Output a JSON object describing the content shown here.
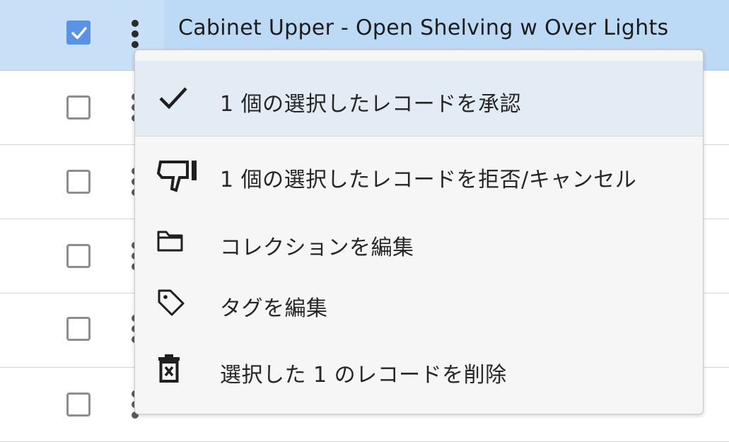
{
  "selected_row": {
    "title": "Cabinet Upper - Open Shelving w Over Lights"
  },
  "icons": {
    "row_checkbox_checked": "checkbox-checked-icon",
    "row_menu": "kebab-menu-icon",
    "approve": "check-icon",
    "reject": "thumbs-down-icon",
    "collection": "folder-icon",
    "tag": "tag-icon",
    "delete": "trash-icon"
  },
  "context_menu": {
    "approve_label": "1 個の選択したレコードを承認",
    "reject_label": "1 個の選択したレコードを拒否/キャンセル",
    "collection_label": "コレクションを編集",
    "tag_label": "タグを編集",
    "delete_label": "選択した 1 のレコードを削除"
  },
  "colors": {
    "selected_row_bg": "#c7dff7",
    "checkbox_checked": "#5a92e8",
    "menu_hover_bg": "#e3ebf5",
    "menu_bg": "#f6f6f6"
  }
}
